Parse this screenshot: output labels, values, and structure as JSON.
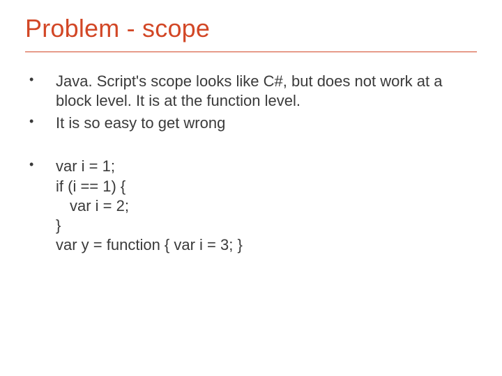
{
  "title": "Problem - scope",
  "bullets": {
    "b1": "Java. Script's scope looks like C#, but does not work at a block level.  It is at the function level.",
    "b2": "It is so easy to get wrong",
    "code": {
      "l1": "var i = 1;",
      "l2": "if (i == 1) {",
      "l3": "var i = 2;",
      "l4": "}",
      "l5": "var y = function { var i = 3; }"
    }
  }
}
